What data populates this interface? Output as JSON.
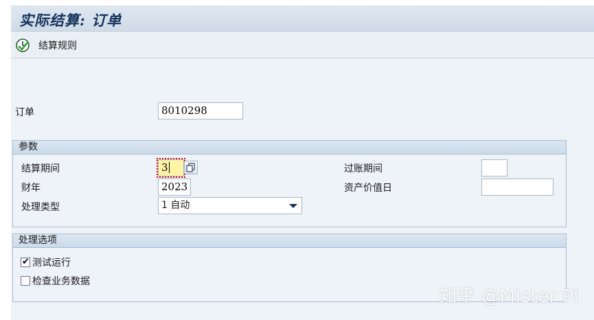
{
  "window": {
    "title": "实际结算: 订单"
  },
  "toolbar": {
    "settlement_rule_label": "结算规则",
    "settlement_rule_icon": "clock-check-icon"
  },
  "order": {
    "label": "订单",
    "value": "8010298"
  },
  "params": {
    "heading": "参数",
    "period_label": "结算期间",
    "period_value": "3",
    "fiscal_year_label": "财年",
    "fiscal_year_value": "2023",
    "processing_type_label": "处理类型",
    "processing_type_value": "1 自动",
    "posting_period_label": "过账期间",
    "posting_period_value": "",
    "asset_value_date_label": "资产价值日",
    "asset_value_date_value": ""
  },
  "options": {
    "heading": "处理选项",
    "test_run_label": "测试运行",
    "test_run_checked": true,
    "check_biz_data_label": "检查业务数据",
    "check_biz_data_checked": false
  },
  "watermark": "知乎 @Mister Pi"
}
